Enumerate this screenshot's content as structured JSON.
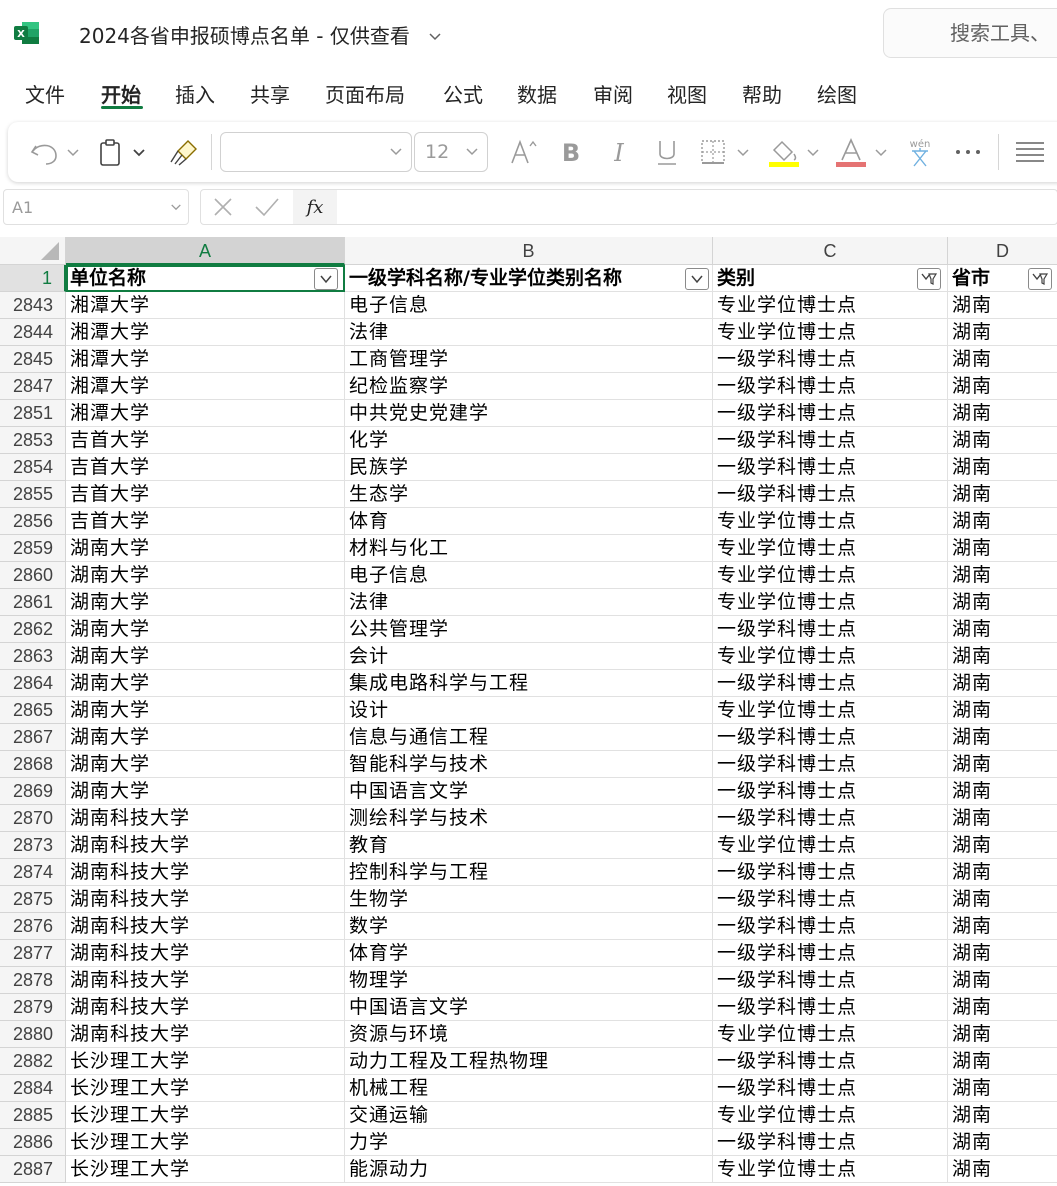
{
  "app": {
    "icon": "excel-icon",
    "accent": "#107c41"
  },
  "title": {
    "document": "2024各省申报硕博点名单 - 仅供查看"
  },
  "search": {
    "placeholder": "搜索工具、"
  },
  "tabs": [
    {
      "label": "文件",
      "active": false
    },
    {
      "label": "开始",
      "active": true
    },
    {
      "label": "插入",
      "active": false
    },
    {
      "label": "共享",
      "active": false
    },
    {
      "label": "页面布局",
      "active": false
    },
    {
      "label": "公式",
      "active": false
    },
    {
      "label": "数据",
      "active": false
    },
    {
      "label": "审阅",
      "active": false
    },
    {
      "label": "视图",
      "active": false
    },
    {
      "label": "帮助",
      "active": false
    },
    {
      "label": "绘图",
      "active": false
    }
  ],
  "ribbon": {
    "font_name": "",
    "font_size": "12",
    "icons": [
      "undo-icon",
      "paste-icon",
      "format-painter-icon",
      "increase-font-icon",
      "bold-icon",
      "italic-icon",
      "underline-icon",
      "borders-icon",
      "fill-color-icon",
      "font-color-icon",
      "phonetic-icon",
      "more-icon",
      "align-icon"
    ],
    "fill_color": "#ffff00",
    "font_color": "#e53935"
  },
  "formula_bar": {
    "name_box": "A1",
    "formula": ""
  },
  "columns": [
    "A",
    "B",
    "C",
    "D"
  ],
  "header_row": {
    "row_number": "1",
    "cells": [
      "单位名称",
      "一级学科名称/专业学位类别名称",
      "类别",
      "省市"
    ]
  },
  "rows": [
    {
      "num": "2843",
      "cells": [
        "湘潭大学",
        "电子信息",
        "专业学位博士点",
        "湖南"
      ]
    },
    {
      "num": "2844",
      "cells": [
        "湘潭大学",
        "法律",
        "专业学位博士点",
        "湖南"
      ]
    },
    {
      "num": "2845",
      "cells": [
        "湘潭大学",
        "工商管理学",
        "一级学科博士点",
        "湖南"
      ]
    },
    {
      "num": "2847",
      "cells": [
        "湘潭大学",
        "纪检监察学",
        "一级学科博士点",
        "湖南"
      ]
    },
    {
      "num": "2851",
      "cells": [
        "湘潭大学",
        "中共党史党建学",
        "一级学科博士点",
        "湖南"
      ]
    },
    {
      "num": "2853",
      "cells": [
        "吉首大学",
        "化学",
        "一级学科博士点",
        "湖南"
      ]
    },
    {
      "num": "2854",
      "cells": [
        "吉首大学",
        "民族学",
        "一级学科博士点",
        "湖南"
      ]
    },
    {
      "num": "2855",
      "cells": [
        "吉首大学",
        "生态学",
        "一级学科博士点",
        "湖南"
      ]
    },
    {
      "num": "2856",
      "cells": [
        "吉首大学",
        "体育",
        "专业学位博士点",
        "湖南"
      ]
    },
    {
      "num": "2859",
      "cells": [
        "湖南大学",
        "材料与化工",
        "专业学位博士点",
        "湖南"
      ]
    },
    {
      "num": "2860",
      "cells": [
        "湖南大学",
        "电子信息",
        "专业学位博士点",
        "湖南"
      ]
    },
    {
      "num": "2861",
      "cells": [
        "湖南大学",
        "法律",
        "专业学位博士点",
        "湖南"
      ]
    },
    {
      "num": "2862",
      "cells": [
        "湖南大学",
        "公共管理学",
        "一级学科博士点",
        "湖南"
      ]
    },
    {
      "num": "2863",
      "cells": [
        "湖南大学",
        "会计",
        "专业学位博士点",
        "湖南"
      ]
    },
    {
      "num": "2864",
      "cells": [
        "湖南大学",
        "集成电路科学与工程",
        "一级学科博士点",
        "湖南"
      ]
    },
    {
      "num": "2865",
      "cells": [
        "湖南大学",
        "设计",
        "专业学位博士点",
        "湖南"
      ]
    },
    {
      "num": "2867",
      "cells": [
        "湖南大学",
        "信息与通信工程",
        "一级学科博士点",
        "湖南"
      ]
    },
    {
      "num": "2868",
      "cells": [
        "湖南大学",
        "智能科学与技术",
        "一级学科博士点",
        "湖南"
      ]
    },
    {
      "num": "2869",
      "cells": [
        "湖南大学",
        "中国语言文学",
        "一级学科博士点",
        "湖南"
      ]
    },
    {
      "num": "2870",
      "cells": [
        "湖南科技大学",
        "测绘科学与技术",
        "一级学科博士点",
        "湖南"
      ]
    },
    {
      "num": "2873",
      "cells": [
        "湖南科技大学",
        "教育",
        "专业学位博士点",
        "湖南"
      ]
    },
    {
      "num": "2874",
      "cells": [
        "湖南科技大学",
        "控制科学与工程",
        "一级学科博士点",
        "湖南"
      ]
    },
    {
      "num": "2875",
      "cells": [
        "湖南科技大学",
        "生物学",
        "一级学科博士点",
        "湖南"
      ]
    },
    {
      "num": "2876",
      "cells": [
        "湖南科技大学",
        "数学",
        "一级学科博士点",
        "湖南"
      ]
    },
    {
      "num": "2877",
      "cells": [
        "湖南科技大学",
        "体育学",
        "一级学科博士点",
        "湖南"
      ]
    },
    {
      "num": "2878",
      "cells": [
        "湖南科技大学",
        "物理学",
        "一级学科博士点",
        "湖南"
      ]
    },
    {
      "num": "2879",
      "cells": [
        "湖南科技大学",
        "中国语言文学",
        "一级学科博士点",
        "湖南"
      ]
    },
    {
      "num": "2880",
      "cells": [
        "湖南科技大学",
        "资源与环境",
        "专业学位博士点",
        "湖南"
      ]
    },
    {
      "num": "2882",
      "cells": [
        "长沙理工大学",
        "动力工程及工程热物理",
        "一级学科博士点",
        "湖南"
      ]
    },
    {
      "num": "2884",
      "cells": [
        "长沙理工大学",
        "机械工程",
        "一级学科博士点",
        "湖南"
      ]
    },
    {
      "num": "2885",
      "cells": [
        "长沙理工大学",
        "交通运输",
        "专业学位博士点",
        "湖南"
      ]
    },
    {
      "num": "2886",
      "cells": [
        "长沙理工大学",
        "力学",
        "一级学科博士点",
        "湖南"
      ]
    },
    {
      "num": "2887",
      "cells": [
        "长沙理工大学",
        "能源动力",
        "专业学位博士点",
        "湖南"
      ]
    }
  ],
  "filters": [
    "dropdown-filter-icon",
    "dropdown-filter-icon",
    "active-filter-icon",
    "active-filter-icon"
  ]
}
